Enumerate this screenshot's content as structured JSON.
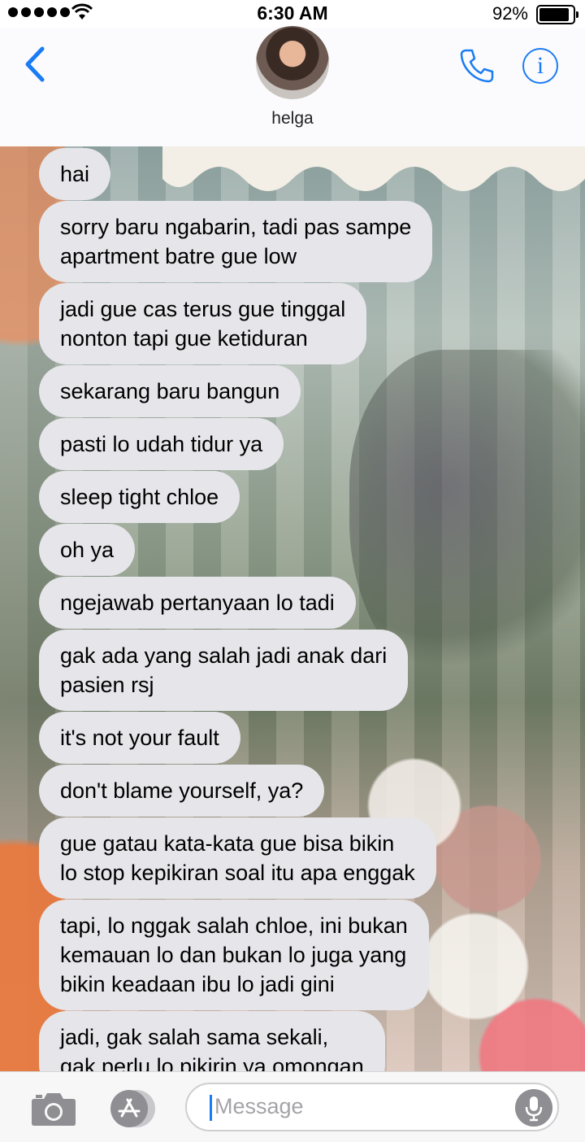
{
  "status_bar": {
    "time": "6:30 AM",
    "battery": "92%",
    "signal_bars": 5
  },
  "header": {
    "contact_name": "helga"
  },
  "messages": [
    "hai",
    "sorry baru ngabarin, tadi pas sampe\napartment batre gue low",
    "jadi gue cas terus gue tinggal\nnonton tapi gue ketiduran",
    "sekarang baru bangun",
    "pasti lo udah tidur ya",
    "sleep tight chloe",
    "oh ya",
    "ngejawab pertanyaan lo tadi",
    "gak ada yang salah jadi anak dari\npasien rsj",
    "it's not your fault",
    "don't blame yourself, ya?",
    "gue gatau kata-kata gue bisa bikin\nlo stop kepikiran soal itu apa enggak",
    "tapi, lo nggak salah chloe, ini bukan\nkemauan lo dan bukan lo juga yang\nbikin keadaan ibu lo jadi gini",
    "jadi, gak salah sama sekali,\ngak perlu lo pikirin ya omongan"
  ],
  "input": {
    "placeholder": "Message"
  },
  "colors": {
    "accent": "#1a7cf5",
    "bubble": "#e5e5ea"
  }
}
